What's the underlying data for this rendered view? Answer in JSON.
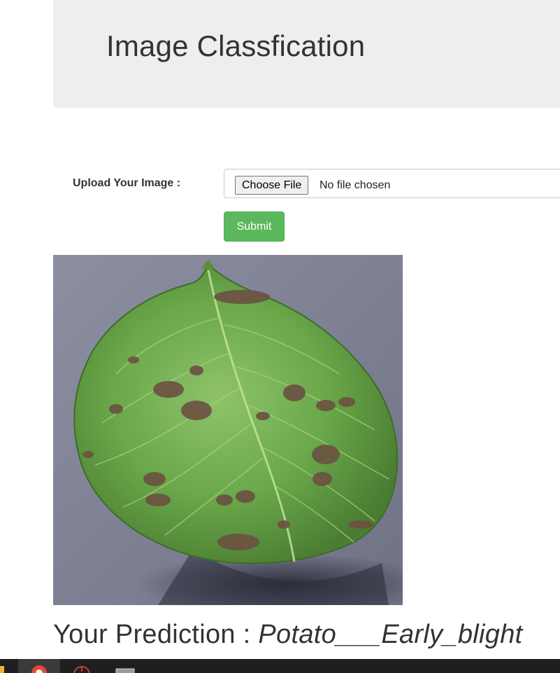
{
  "header": {
    "title": "Image Classfication"
  },
  "form": {
    "upload_label": "Upload Your Image :",
    "choose_file_label": "Choose File",
    "file_status": "No file chosen",
    "submit_label": "Submit"
  },
  "result": {
    "prediction_label": "Your Prediction :",
    "prediction_value": "Potato___Early_blight"
  },
  "colors": {
    "jumbotron_bg": "#eeeeee",
    "submit_bg": "#5cb85c",
    "text": "#333333",
    "taskbar_bg": "#1f1f1f"
  },
  "icons": {
    "taskbar": [
      "windows-start-icon",
      "chrome-icon",
      "power-icon",
      "monitor-icon"
    ]
  }
}
